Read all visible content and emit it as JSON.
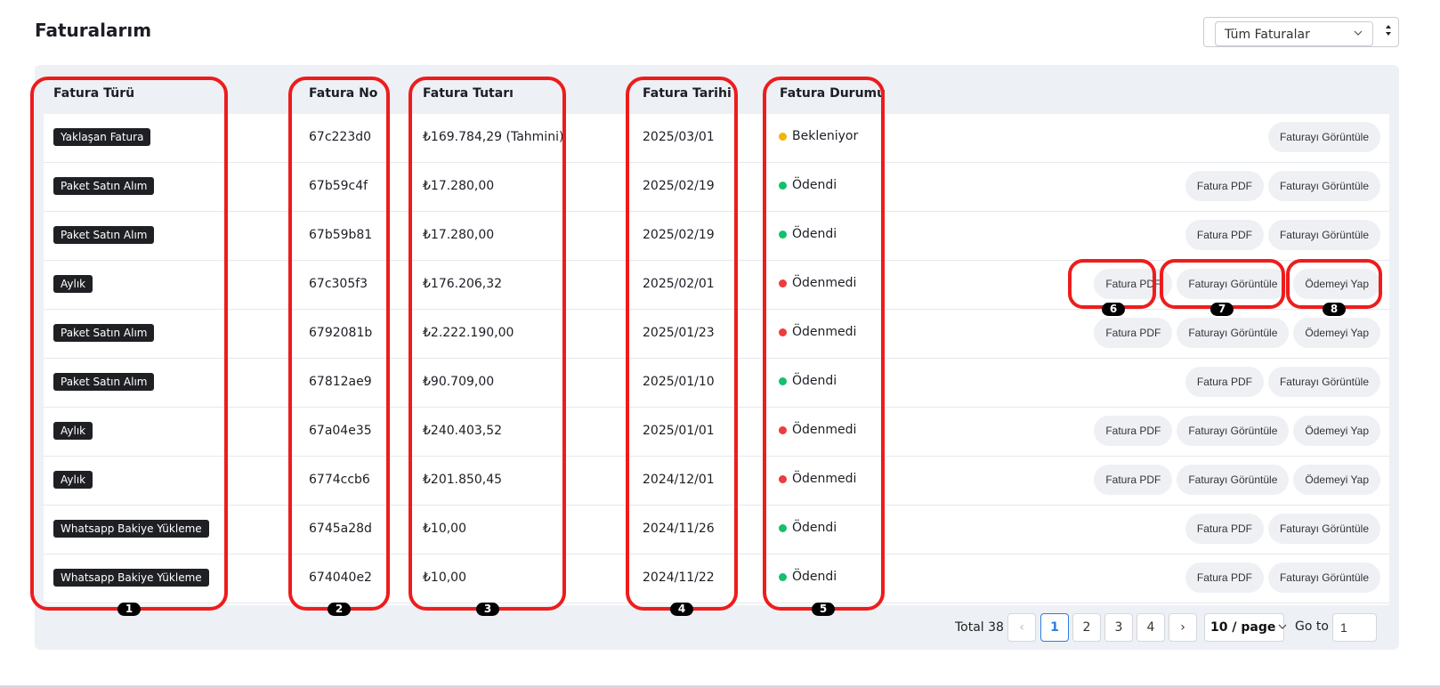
{
  "page": {
    "title": "Faturalarım"
  },
  "filter": {
    "selected": "Tüm Faturalar"
  },
  "table": {
    "headers": {
      "type": "Fatura Türü",
      "no": "Fatura No",
      "amount": "Fatura Tutarı",
      "date": "Fatura Tarihi",
      "status": "Fatura Durumu"
    },
    "rows": [
      {
        "type": "Yaklaşan Fatura",
        "no": "67c223d0",
        "amount": "₺169.784,29 (Tahmini)",
        "date": "2025/03/01",
        "status": "Bekleniyor",
        "status_color": "#f5b300",
        "actions": [
          "Faturayı Görüntüle"
        ]
      },
      {
        "type": "Paket Satın Alım",
        "no": "67b59c4f",
        "amount": "₺17.280,00",
        "date": "2025/02/19",
        "status": "Ödendi",
        "status_color": "#13c06b",
        "actions": [
          "Fatura PDF",
          "Faturayı Görüntüle"
        ]
      },
      {
        "type": "Paket Satın Alım",
        "no": "67b59b81",
        "amount": "₺17.280,00",
        "date": "2025/02/19",
        "status": "Ödendi",
        "status_color": "#13c06b",
        "actions": [
          "Fatura PDF",
          "Faturayı Görüntüle"
        ]
      },
      {
        "type": "Aylık",
        "no": "67c305f3",
        "amount": "₺176.206,32",
        "date": "2025/02/01",
        "status": "Ödenmedi",
        "status_color": "#ee3b3b",
        "actions": [
          "Fatura PDF",
          "Faturayı Görüntüle",
          "Ödemeyi Yap"
        ]
      },
      {
        "type": "Paket Satın Alım",
        "no": "6792081b",
        "amount": "₺2.222.190,00",
        "date": "2025/01/23",
        "status": "Ödenmedi",
        "status_color": "#ee3b3b",
        "actions": [
          "Fatura PDF",
          "Faturayı Görüntüle",
          "Ödemeyi Yap"
        ]
      },
      {
        "type": "Paket Satın Alım",
        "no": "67812ae9",
        "amount": "₺90.709,00",
        "date": "2025/01/10",
        "status": "Ödendi",
        "status_color": "#13c06b",
        "actions": [
          "Fatura PDF",
          "Faturayı Görüntüle"
        ]
      },
      {
        "type": "Aylık",
        "no": "67a04e35",
        "amount": "₺240.403,52",
        "date": "2025/01/01",
        "status": "Ödenmedi",
        "status_color": "#ee3b3b",
        "actions": [
          "Fatura PDF",
          "Faturayı Görüntüle",
          "Ödemeyi Yap"
        ]
      },
      {
        "type": "Aylık",
        "no": "6774ccb6",
        "amount": "₺201.850,45",
        "date": "2024/12/01",
        "status": "Ödenmedi",
        "status_color": "#ee3b3b",
        "actions": [
          "Fatura PDF",
          "Faturayı Görüntüle",
          "Ödemeyi Yap"
        ]
      },
      {
        "type": "Whatsapp Bakiye Yükleme",
        "no": "6745a28d",
        "amount": "₺10,00",
        "date": "2024/11/26",
        "status": "Ödendi",
        "status_color": "#13c06b",
        "actions": [
          "Fatura PDF",
          "Faturayı Görüntüle"
        ]
      },
      {
        "type": "Whatsapp Bakiye Yükleme",
        "no": "674040e2",
        "amount": "₺10,00",
        "date": "2024/11/22",
        "status": "Ödendi",
        "status_color": "#13c06b",
        "actions": [
          "Fatura PDF",
          "Faturayı Görüntüle"
        ]
      }
    ]
  },
  "pagination": {
    "total": "Total 38",
    "prev": "‹",
    "pages": [
      "1",
      "2",
      "3",
      "4"
    ],
    "active_page": "1",
    "next": "›",
    "page_size": "10 / page",
    "goto_label": "Go to",
    "goto_value": "1"
  },
  "annotations": [
    "1",
    "2",
    "3",
    "4",
    "5",
    "6",
    "7",
    "8"
  ],
  "colors": {
    "highlight": "#ee1c1c",
    "accent": "#2f7ce0"
  }
}
